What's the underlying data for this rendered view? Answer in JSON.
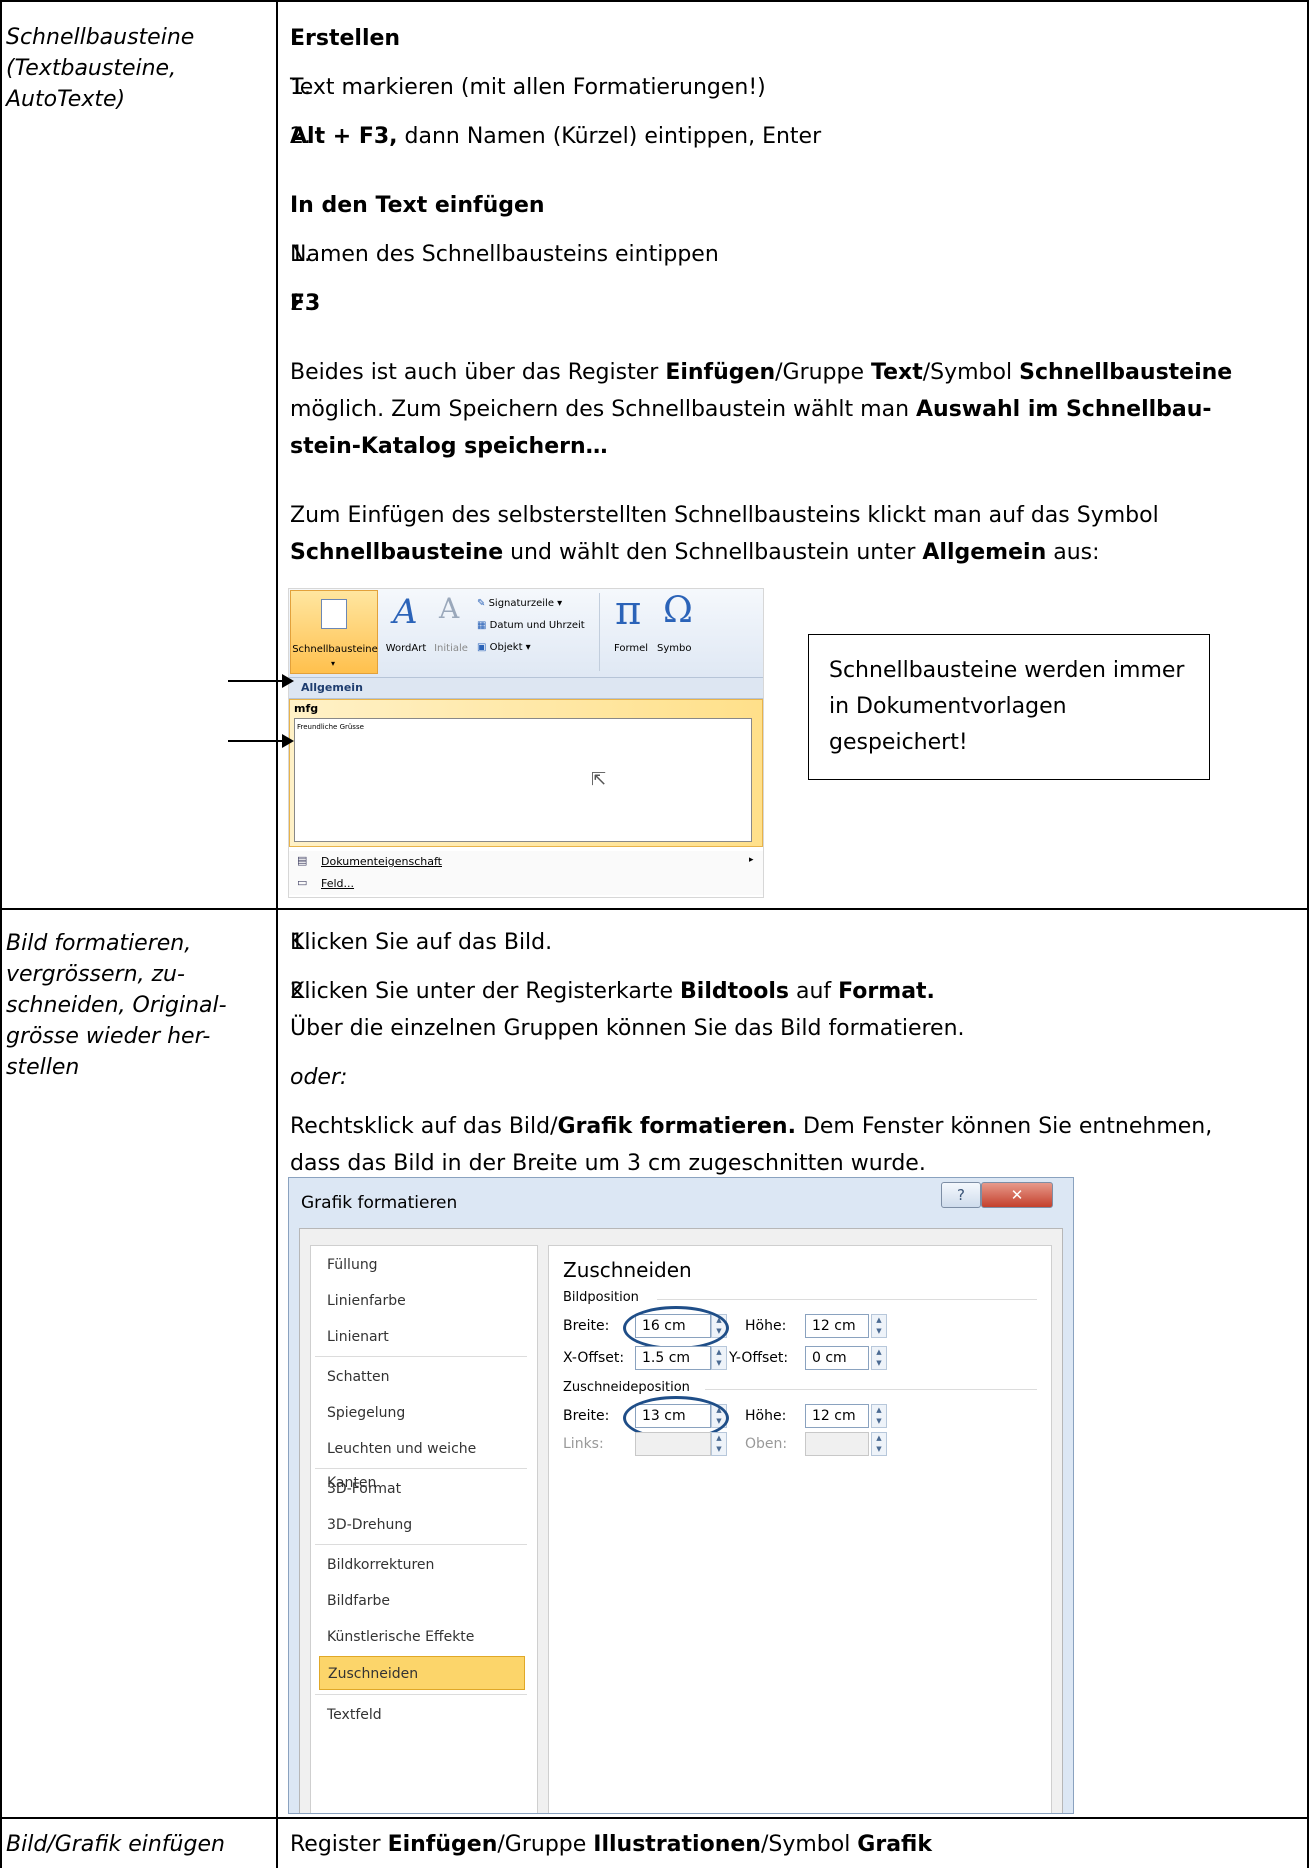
{
  "rows": [
    {
      "topic": [
        "Schnellbausteine",
        "(Textbausteine,",
        "AutoTexte)"
      ],
      "erstellen_heading": "Erstellen",
      "erstellen_step1": "Text markieren (mit allen Formatierungen!)",
      "erstellen_step2_bold": "Alt + F3,",
      "erstellen_step2_rest": " dann Namen (Kürzel) eintippen, Enter",
      "einfuegen_heading": "In den Text einfügen",
      "einfuegen_step1": "Namen des Schnellbausteins eintippen",
      "einfuegen_step2": "F3",
      "para1_a": "Beides ist auch über das Register ",
      "para1_b": "Einfügen",
      "para1_c": "/Gruppe ",
      "para1_d": "Text",
      "para1_e": "/Symbol ",
      "para1_f": "Schnellbausteine",
      "para1_g": "möglich. Zum Speichern des Schnellbaustein wählt man ",
      "para1_h": "Auswahl im Schnellbau-",
      "para1_i": "stein-Katalog speichern…",
      "para2_a": "Zum Einfügen des selbsterstellten Schnellbausteins klickt man auf das Symbol",
      "para2_b": "Schnellbausteine",
      "para2_c": " und wählt den Schnellbaustein unter ",
      "para2_d": "Allgemein",
      "para2_e": " aus:",
      "note": "Schnellbausteine werden immer in Dokumentvorlagen gespeichert!"
    },
    {
      "topic": [
        "Bild formatieren,",
        "vergrössern, zu-",
        "schneiden, Original-",
        "grösse wieder her-",
        "stellen"
      ],
      "step1": "Klicken Sie auf das Bild.",
      "step2_a": "Klicken Sie unter der Registerkarte ",
      "step2_b": "Bildtools",
      "step2_c": " auf ",
      "step2_d": "Format.",
      "step2_e": "Über die einzelnen Gruppen können Sie das Bild formatieren.",
      "oder": "oder:",
      "para_a": "Rechtsklick auf das Bild/",
      "para_b": "Grafik formatieren.",
      "para_c": " Dem Fenster können Sie entnehmen,",
      "para_d": "dass das Bild in der Breite um 3 cm zugeschnitten wurde."
    },
    {
      "topic": [
        "Bild/Grafik einfügen"
      ],
      "text_a": "Register ",
      "text_b": "Einfügen",
      "text_c": "/Gruppe ",
      "text_d": "Illustrationen",
      "text_e": "/Symbol ",
      "text_f": "Grafik"
    }
  ],
  "ribbon": {
    "btn1": "Schnellbausteine",
    "btn2": "WordArt",
    "btn3": "Initiale",
    "signatur": "Signaturzeile ▾",
    "datum": "Datum und Uhrzeit",
    "objekt": "Objekt ▾",
    "formel": "Formel",
    "symbol": "Symbo",
    "gallery_header": "Allgemein",
    "entry_name": "mfg",
    "entry_text": "Freundliche Grüsse",
    "menu1": "Dokumenteigenschaft",
    "menu2": "Feld..."
  },
  "dialog": {
    "title": "Grafik formatieren",
    "help": "?",
    "close": "✕",
    "sidebar": [
      "Füllung",
      "Linienfarbe",
      "Linienart",
      "Schatten",
      "Spiegelung",
      "Leuchten und weiche Kanten",
      "3D-Format",
      "3D-Drehung",
      "Bildkorrekturen",
      "Bildfarbe",
      "Künstlerische Effekte",
      "Zuschneiden",
      "Textfeld"
    ],
    "panel_title": "Zuschneiden",
    "bildposition": "Bildposition",
    "breite_label": "Breite:",
    "breite_value": "16 cm",
    "hoehe_label": "Höhe:",
    "hoehe_value": "12 cm",
    "xoffset_label": "X-Offset:",
    "xoffset_value": "1.5 cm",
    "yoffset_label": "Y-Offset:",
    "yoffset_value": "0 cm",
    "zuschneideposition": "Zuschneideposition",
    "breite2_label": "Breite:",
    "breite2_value": "13 cm",
    "hoehe2_label": "Höhe:",
    "hoehe2_value": "12 cm",
    "links_label": "Links:",
    "oben_label": "Oben:"
  }
}
